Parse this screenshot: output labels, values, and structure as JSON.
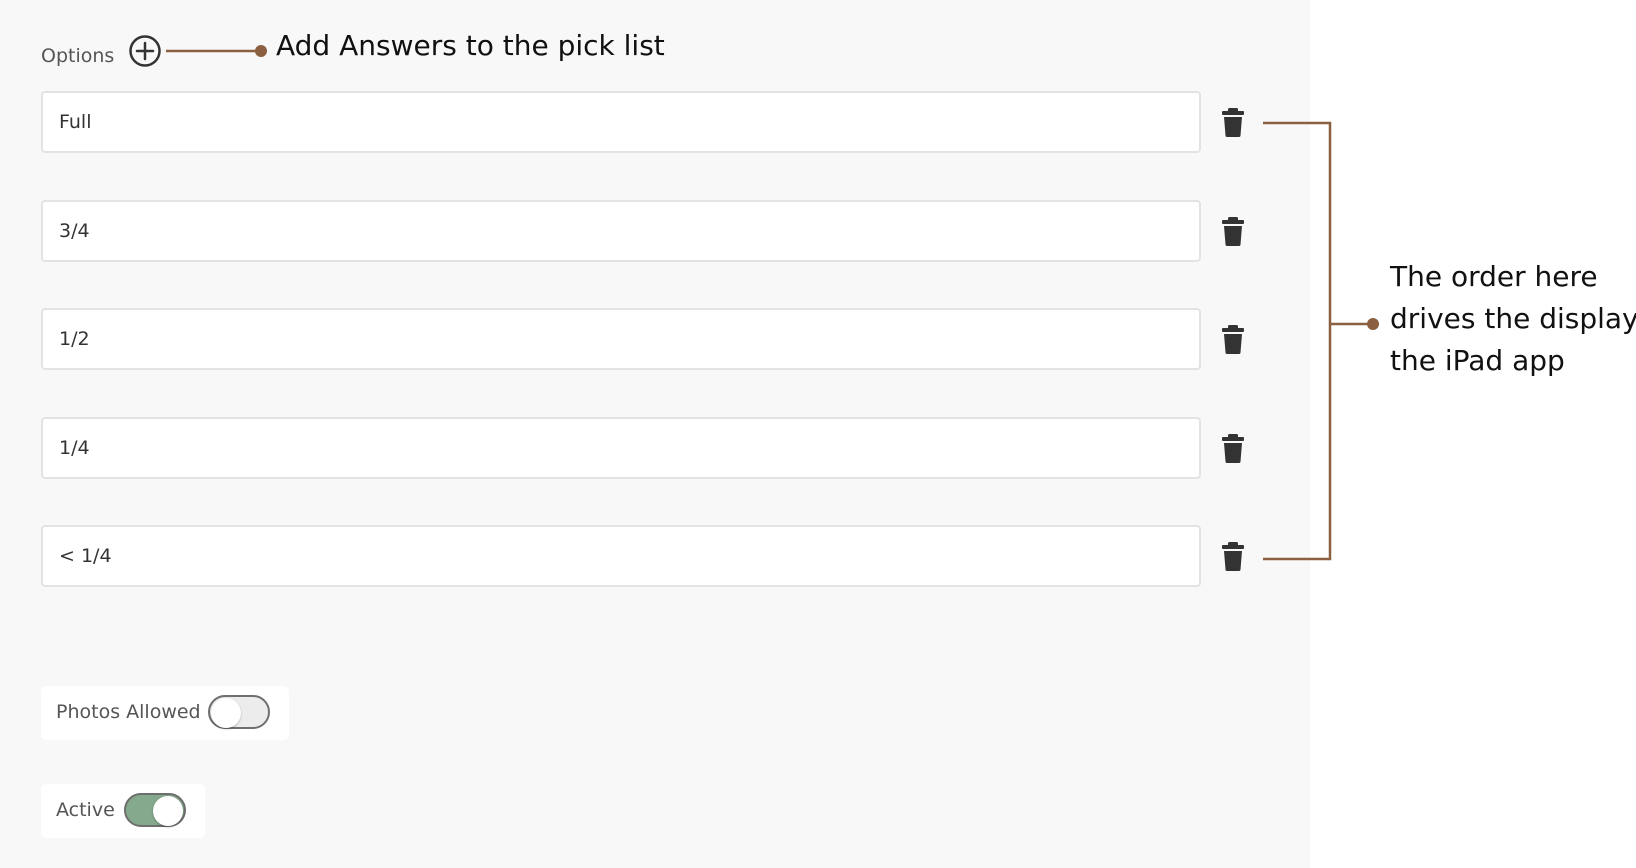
{
  "options": {
    "label": "Options",
    "items": [
      {
        "value": "Full"
      },
      {
        "value": "3/4"
      },
      {
        "value": "1/2"
      },
      {
        "value": "1/4"
      },
      {
        "value": "< 1/4"
      }
    ]
  },
  "toggles": {
    "photos_allowed": {
      "label": "Photos Allowed",
      "on": false
    },
    "active": {
      "label": "Active",
      "on": true
    }
  },
  "annotations": {
    "add_answers": "Add Answers to the pick list",
    "order_lines": [
      "The order here",
      "drives the display",
      "the iPad app"
    ]
  },
  "colors": {
    "annotation": "#8a6040",
    "toggle_on": "#84a98c",
    "panel_bg": "#f8f8f8"
  },
  "icons": {
    "add": "plus-circle-icon",
    "delete": "trash-icon"
  }
}
